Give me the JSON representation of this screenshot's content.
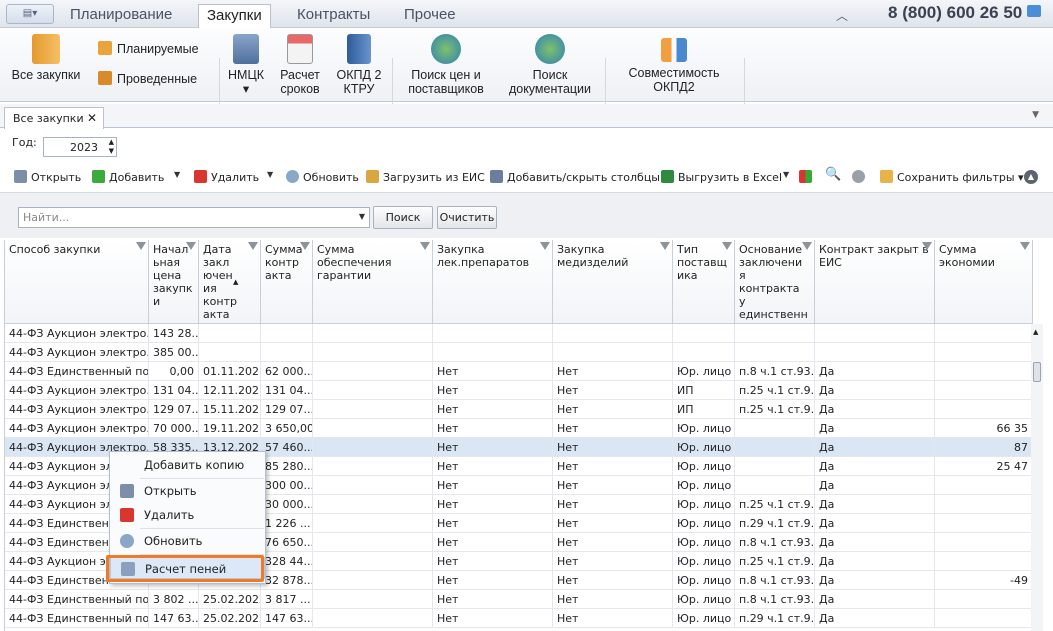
{
  "menubar": {
    "tabs": [
      "Планирование",
      "Закупки",
      "Контракты",
      "Прочее"
    ],
    "active": 1,
    "phone": "8 (800) 600 26 50"
  },
  "ribbon": {
    "all": "Все закупки",
    "planned": "Планируемые",
    "held": "Проведенные",
    "nmck": "НМЦК",
    "calc1": "Расчет",
    "calc2": "сроков",
    "okpd1": "ОКПД 2",
    "okpd2": "КТРУ",
    "search1a": "Поиск цен и",
    "search1b": "поставщиков",
    "search2a": "Поиск",
    "search2b": "документации",
    "compat1": "Совместимость",
    "compat2": "ОКПД2"
  },
  "doc": {
    "tab": "Все закупки",
    "year_label": "Год:",
    "year": "2023"
  },
  "toolbar": {
    "open": "Открыть",
    "add": "Добавить",
    "delete": "Удалить",
    "refresh": "Обновить",
    "load": "Загрузить из ЕИС",
    "cols": "Добавить/скрыть столбцы",
    "excel": "Выгрузить в Excel",
    "savefilters": "Сохранить фильтры"
  },
  "filter": {
    "placeholder": "Найти...",
    "search": "Поиск",
    "clear": "Очистить"
  },
  "columns": [
    "Способ закупки",
    "Начальная цена закупки",
    "Дата заключения контракта",
    "Сумма контракта",
    "Сумма обеспечения гарантии",
    "Закупка лек.препаратов",
    "Закупка медизделий",
    "Тип поставщика",
    "Основание заключения контракта у единственн",
    "Контракт закрыт в ЕИС",
    "Сумма экономии"
  ],
  "header_lines": [
    [
      "Способ закупки"
    ],
    [
      "Начал",
      "ьная",
      "цена",
      "закупк",
      "и"
    ],
    [
      "Дата",
      "закл",
      "ючен",
      "ия",
      "контр",
      "акта"
    ],
    [
      "Сумма",
      "контр",
      "акта"
    ],
    [
      "Сумма обеспечения",
      "гарантии"
    ],
    [
      "Закупка",
      "лек.препаратов"
    ],
    [
      "Закупка",
      "медизделий"
    ],
    [
      "Тип",
      "поставщ",
      "ика"
    ],
    [
      "Основание",
      "заключени",
      "я",
      "контракта",
      "у",
      "единственн"
    ],
    [
      "Контракт закрыт в",
      "ЕИС"
    ],
    [
      "Сумма экономии"
    ]
  ],
  "rows": [
    [
      "44-ФЗ Аукцион электро...",
      "143 28...",
      "",
      "",
      "",
      "",
      "",
      "",
      "",
      "",
      ""
    ],
    [
      "44-ФЗ Аукцион электро...",
      "385 00...",
      "",
      "",
      "",
      "",
      "",
      "",
      "",
      "",
      ""
    ],
    [
      "44-ФЗ Единственный по...",
      "0,00",
      "01.11.2021",
      "62 000...",
      "",
      "Нет",
      "Нет",
      "Юр. лицо",
      "п.8 ч.1 ст.93...",
      "Да",
      ""
    ],
    [
      "44-ФЗ Аукцион электро...",
      "131 04...",
      "12.11.2021",
      "131 04...",
      "",
      "Нет",
      "Нет",
      "ИП",
      "п.25 ч.1 ст.9...",
      "Да",
      ""
    ],
    [
      "44-ФЗ Аукцион электро...",
      "129 07...",
      "15.11.2021",
      "129 07...",
      "",
      "Нет",
      "Нет",
      "ИП",
      "п.25 ч.1 ст.9...",
      "Да",
      ""
    ],
    [
      "44-ФЗ Аукцион электро...",
      "70 000...",
      "19.11.2021",
      "3 650,00",
      "",
      "Нет",
      "Нет",
      "Юр. лицо",
      "",
      "Да",
      "66 35"
    ],
    [
      "44-ФЗ Аукцион электро...",
      "58 335...",
      "13.12.2021",
      "57 460...",
      "",
      "Нет",
      "Нет",
      "Юр. лицо",
      "",
      "Да",
      "87"
    ],
    [
      "44-ФЗ Аукцион элект",
      "",
      "",
      "85 280...",
      "",
      "Нет",
      "Нет",
      "Юр. лицо",
      "",
      "Да",
      "25 47"
    ],
    [
      "44-ФЗ Аукцион элект",
      "",
      "",
      "300 00...",
      "",
      "Нет",
      "Нет",
      "Юр. лицо",
      "",
      "Да",
      ""
    ],
    [
      "44-ФЗ Аукцион элект",
      "",
      "",
      "30 000...",
      "",
      "Нет",
      "Нет",
      "Юр. лицо",
      "п.25 ч.1 ст.9...",
      "Да",
      ""
    ],
    [
      "44-ФЗ Единственный",
      "",
      "",
      "1 226 ...",
      "",
      "Нет",
      "Нет",
      "Юр. лицо",
      "п.29 ч.1 ст.9...",
      "Да",
      ""
    ],
    [
      "44-ФЗ Единственный",
      "",
      "",
      "76 650...",
      "",
      "Нет",
      "Нет",
      "Юр. лицо",
      "п.8 ч.1 ст.93...",
      "Да",
      ""
    ],
    [
      "44-ФЗ Аукцион элект",
      "",
      "",
      "328 44...",
      "",
      "Нет",
      "Нет",
      "Юр. лицо",
      "п.25 ч.1 ст.9...",
      "Да",
      ""
    ],
    [
      "44-ФЗ Единственный",
      "",
      "",
      "32 878...",
      "",
      "Нет",
      "Нет",
      "Юр. лицо",
      "п.8 ч.1 ст.93...",
      "Да",
      "-49"
    ],
    [
      "44-ФЗ Единственный по...",
      "3 802 ...",
      "25.02.2022",
      "3 817 ...",
      "",
      "Нет",
      "Нет",
      "Юр. лицо",
      "п.8 ч.1 ст.93...",
      "Да",
      ""
    ],
    [
      "44-ФЗ Единственный по...",
      "147 63...",
      "25.02.2022",
      "147 63...",
      "",
      "Нет",
      "Нет",
      "Юр. лицо",
      "п.29 ч.1 ст.9...",
      "Да",
      ""
    ]
  ],
  "context_menu": [
    "Добавить копию",
    "Открыть",
    "Удалить",
    "Обновить",
    "Расчет пеней"
  ],
  "colors": {
    "highlight": "#f07b26",
    "selected_row": "#dbe6f5"
  }
}
